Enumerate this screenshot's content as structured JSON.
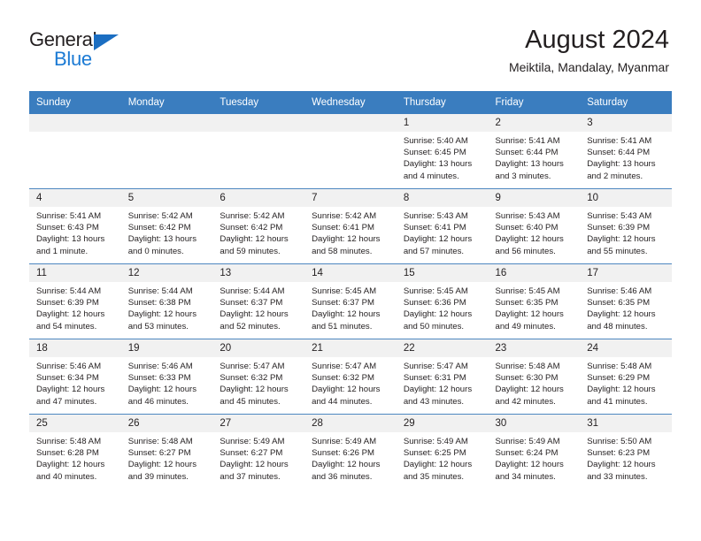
{
  "logo": {
    "word_one": "General",
    "word_two": "Blue",
    "triangle_color": "#1b6ec2",
    "blue_color": "#1b7ad4"
  },
  "header": {
    "title": "August 2024",
    "subtitle": "Meiktila, Mandalay, Myanmar",
    "accent_color": "#3a7dbf"
  },
  "calendar": {
    "weekday_headers": [
      "Sunday",
      "Monday",
      "Tuesday",
      "Wednesday",
      "Thursday",
      "Friday",
      "Saturday"
    ],
    "weeks": [
      [
        {
          "day": "",
          "sunrise": "",
          "sunset": "",
          "daylight": "",
          "daylight2": ""
        },
        {
          "day": "",
          "sunrise": "",
          "sunset": "",
          "daylight": "",
          "daylight2": ""
        },
        {
          "day": "",
          "sunrise": "",
          "sunset": "",
          "daylight": "",
          "daylight2": ""
        },
        {
          "day": "",
          "sunrise": "",
          "sunset": "",
          "daylight": "",
          "daylight2": ""
        },
        {
          "day": "1",
          "sunrise": "Sunrise: 5:40 AM",
          "sunset": "Sunset: 6:45 PM",
          "daylight": "Daylight: 13 hours",
          "daylight2": "and 4 minutes."
        },
        {
          "day": "2",
          "sunrise": "Sunrise: 5:41 AM",
          "sunset": "Sunset: 6:44 PM",
          "daylight": "Daylight: 13 hours",
          "daylight2": "and 3 minutes."
        },
        {
          "day": "3",
          "sunrise": "Sunrise: 5:41 AM",
          "sunset": "Sunset: 6:44 PM",
          "daylight": "Daylight: 13 hours",
          "daylight2": "and 2 minutes."
        }
      ],
      [
        {
          "day": "4",
          "sunrise": "Sunrise: 5:41 AM",
          "sunset": "Sunset: 6:43 PM",
          "daylight": "Daylight: 13 hours",
          "daylight2": "and 1 minute."
        },
        {
          "day": "5",
          "sunrise": "Sunrise: 5:42 AM",
          "sunset": "Sunset: 6:42 PM",
          "daylight": "Daylight: 13 hours",
          "daylight2": "and 0 minutes."
        },
        {
          "day": "6",
          "sunrise": "Sunrise: 5:42 AM",
          "sunset": "Sunset: 6:42 PM",
          "daylight": "Daylight: 12 hours",
          "daylight2": "and 59 minutes."
        },
        {
          "day": "7",
          "sunrise": "Sunrise: 5:42 AM",
          "sunset": "Sunset: 6:41 PM",
          "daylight": "Daylight: 12 hours",
          "daylight2": "and 58 minutes."
        },
        {
          "day": "8",
          "sunrise": "Sunrise: 5:43 AM",
          "sunset": "Sunset: 6:41 PM",
          "daylight": "Daylight: 12 hours",
          "daylight2": "and 57 minutes."
        },
        {
          "day": "9",
          "sunrise": "Sunrise: 5:43 AM",
          "sunset": "Sunset: 6:40 PM",
          "daylight": "Daylight: 12 hours",
          "daylight2": "and 56 minutes."
        },
        {
          "day": "10",
          "sunrise": "Sunrise: 5:43 AM",
          "sunset": "Sunset: 6:39 PM",
          "daylight": "Daylight: 12 hours",
          "daylight2": "and 55 minutes."
        }
      ],
      [
        {
          "day": "11",
          "sunrise": "Sunrise: 5:44 AM",
          "sunset": "Sunset: 6:39 PM",
          "daylight": "Daylight: 12 hours",
          "daylight2": "and 54 minutes."
        },
        {
          "day": "12",
          "sunrise": "Sunrise: 5:44 AM",
          "sunset": "Sunset: 6:38 PM",
          "daylight": "Daylight: 12 hours",
          "daylight2": "and 53 minutes."
        },
        {
          "day": "13",
          "sunrise": "Sunrise: 5:44 AM",
          "sunset": "Sunset: 6:37 PM",
          "daylight": "Daylight: 12 hours",
          "daylight2": "and 52 minutes."
        },
        {
          "day": "14",
          "sunrise": "Sunrise: 5:45 AM",
          "sunset": "Sunset: 6:37 PM",
          "daylight": "Daylight: 12 hours",
          "daylight2": "and 51 minutes."
        },
        {
          "day": "15",
          "sunrise": "Sunrise: 5:45 AM",
          "sunset": "Sunset: 6:36 PM",
          "daylight": "Daylight: 12 hours",
          "daylight2": "and 50 minutes."
        },
        {
          "day": "16",
          "sunrise": "Sunrise: 5:45 AM",
          "sunset": "Sunset: 6:35 PM",
          "daylight": "Daylight: 12 hours",
          "daylight2": "and 49 minutes."
        },
        {
          "day": "17",
          "sunrise": "Sunrise: 5:46 AM",
          "sunset": "Sunset: 6:35 PM",
          "daylight": "Daylight: 12 hours",
          "daylight2": "and 48 minutes."
        }
      ],
      [
        {
          "day": "18",
          "sunrise": "Sunrise: 5:46 AM",
          "sunset": "Sunset: 6:34 PM",
          "daylight": "Daylight: 12 hours",
          "daylight2": "and 47 minutes."
        },
        {
          "day": "19",
          "sunrise": "Sunrise: 5:46 AM",
          "sunset": "Sunset: 6:33 PM",
          "daylight": "Daylight: 12 hours",
          "daylight2": "and 46 minutes."
        },
        {
          "day": "20",
          "sunrise": "Sunrise: 5:47 AM",
          "sunset": "Sunset: 6:32 PM",
          "daylight": "Daylight: 12 hours",
          "daylight2": "and 45 minutes."
        },
        {
          "day": "21",
          "sunrise": "Sunrise: 5:47 AM",
          "sunset": "Sunset: 6:32 PM",
          "daylight": "Daylight: 12 hours",
          "daylight2": "and 44 minutes."
        },
        {
          "day": "22",
          "sunrise": "Sunrise: 5:47 AM",
          "sunset": "Sunset: 6:31 PM",
          "daylight": "Daylight: 12 hours",
          "daylight2": "and 43 minutes."
        },
        {
          "day": "23",
          "sunrise": "Sunrise: 5:48 AM",
          "sunset": "Sunset: 6:30 PM",
          "daylight": "Daylight: 12 hours",
          "daylight2": "and 42 minutes."
        },
        {
          "day": "24",
          "sunrise": "Sunrise: 5:48 AM",
          "sunset": "Sunset: 6:29 PM",
          "daylight": "Daylight: 12 hours",
          "daylight2": "and 41 minutes."
        }
      ],
      [
        {
          "day": "25",
          "sunrise": "Sunrise: 5:48 AM",
          "sunset": "Sunset: 6:28 PM",
          "daylight": "Daylight: 12 hours",
          "daylight2": "and 40 minutes."
        },
        {
          "day": "26",
          "sunrise": "Sunrise: 5:48 AM",
          "sunset": "Sunset: 6:27 PM",
          "daylight": "Daylight: 12 hours",
          "daylight2": "and 39 minutes."
        },
        {
          "day": "27",
          "sunrise": "Sunrise: 5:49 AM",
          "sunset": "Sunset: 6:27 PM",
          "daylight": "Daylight: 12 hours",
          "daylight2": "and 37 minutes."
        },
        {
          "day": "28",
          "sunrise": "Sunrise: 5:49 AM",
          "sunset": "Sunset: 6:26 PM",
          "daylight": "Daylight: 12 hours",
          "daylight2": "and 36 minutes."
        },
        {
          "day": "29",
          "sunrise": "Sunrise: 5:49 AM",
          "sunset": "Sunset: 6:25 PM",
          "daylight": "Daylight: 12 hours",
          "daylight2": "and 35 minutes."
        },
        {
          "day": "30",
          "sunrise": "Sunrise: 5:49 AM",
          "sunset": "Sunset: 6:24 PM",
          "daylight": "Daylight: 12 hours",
          "daylight2": "and 34 minutes."
        },
        {
          "day": "31",
          "sunrise": "Sunrise: 5:50 AM",
          "sunset": "Sunset: 6:23 PM",
          "daylight": "Daylight: 12 hours",
          "daylight2": "and 33 minutes."
        }
      ]
    ]
  }
}
